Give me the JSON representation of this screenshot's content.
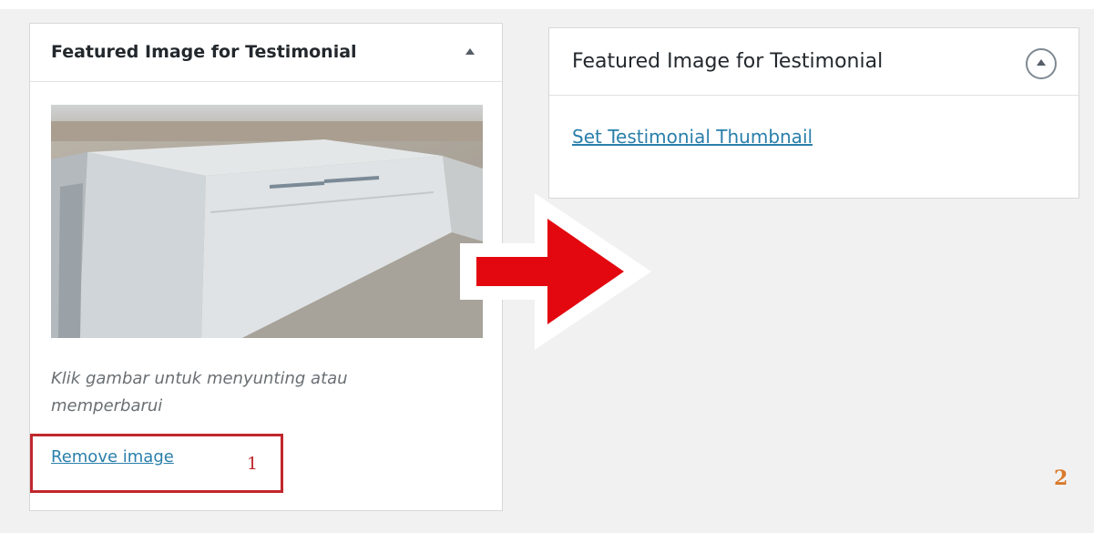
{
  "left_panel": {
    "title": "Featured Image for Testimonial",
    "toggle_icon": "triangle-up-icon",
    "image_caption": "Klik gambar untuk menyunting atau memperbarui",
    "remove_link": "Remove image",
    "step_number": "1",
    "highlight_color": "#c0272d"
  },
  "right_panel": {
    "title": "Featured Image for Testimonial",
    "toggle_icon": "circle-triangle-up-icon",
    "set_link": "Set Testimonial Thumbnail"
  },
  "annotations": {
    "arrow_icon": "arrow-right-icon",
    "arrow_color": "#e3070f",
    "step_number": "2",
    "step_2_color": "#d9792b"
  },
  "colors": {
    "link": "#2a7fab",
    "background": "#f1f1f1"
  }
}
